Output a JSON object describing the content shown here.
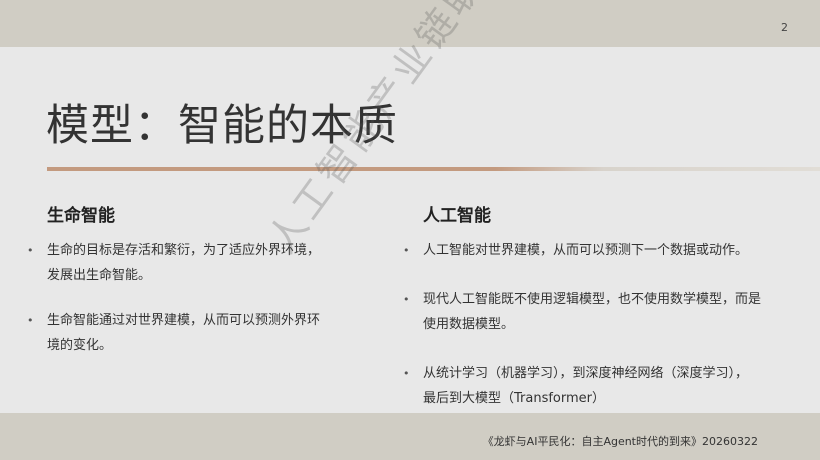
{
  "slide": {
    "page_number": "2",
    "title": "模型：智能的本质",
    "watermark": "人工智能产业链联盟"
  },
  "left_column": {
    "heading": "生命智能",
    "bullets": [
      [
        "生命的目标是存活和繁衍，为了适应外界环境，",
        "发展出生命智能。"
      ],
      [
        "生命智能通过对世界建模，从而可以预测外界环",
        "境的变化。"
      ]
    ]
  },
  "right_column": {
    "heading": "人工智能",
    "bullets": [
      [
        "人工智能对世界建模，从而可以预测下一个数据或动作。"
      ],
      [
        "现代人工智能既不使用逻辑模型，也不使用数学模型，而是",
        "使用数据模型。"
      ],
      [
        "从统计学习（机器学习），到深度神经网络（深度学习），",
        "最后到大模型（Transformer）"
      ]
    ]
  },
  "footer": {
    "text": "《龙虾与AI平民化：自主Agent时代的到来》20260322"
  },
  "bullet_symbol": "•",
  "colors": {
    "band": "#d0cdc4",
    "background": "#e8e8e8",
    "accent_line": "#c39a7f"
  }
}
